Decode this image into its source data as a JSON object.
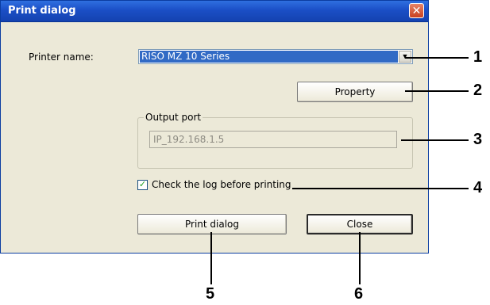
{
  "window": {
    "title": "Print dialog",
    "close_symbol": "✕"
  },
  "printer": {
    "label": "Printer name:",
    "selected": "RISO MZ 10 Series",
    "arrow": "▼"
  },
  "buttons": {
    "property": "Property",
    "print_dialog": "Print dialog",
    "close": "Close"
  },
  "output_port": {
    "group_label": "Output port",
    "value": "IP_192.168.1.5"
  },
  "log_check": {
    "label": "Check the log before printing",
    "checked": true,
    "mark": "✓"
  },
  "callouts": [
    "1",
    "2",
    "3",
    "4",
    "5",
    "6"
  ],
  "colors": {
    "title_bar": "#1b4fc6",
    "dialog_bg": "#ece9d8",
    "selection": "#316ac5",
    "close_button": "#c9401f"
  }
}
